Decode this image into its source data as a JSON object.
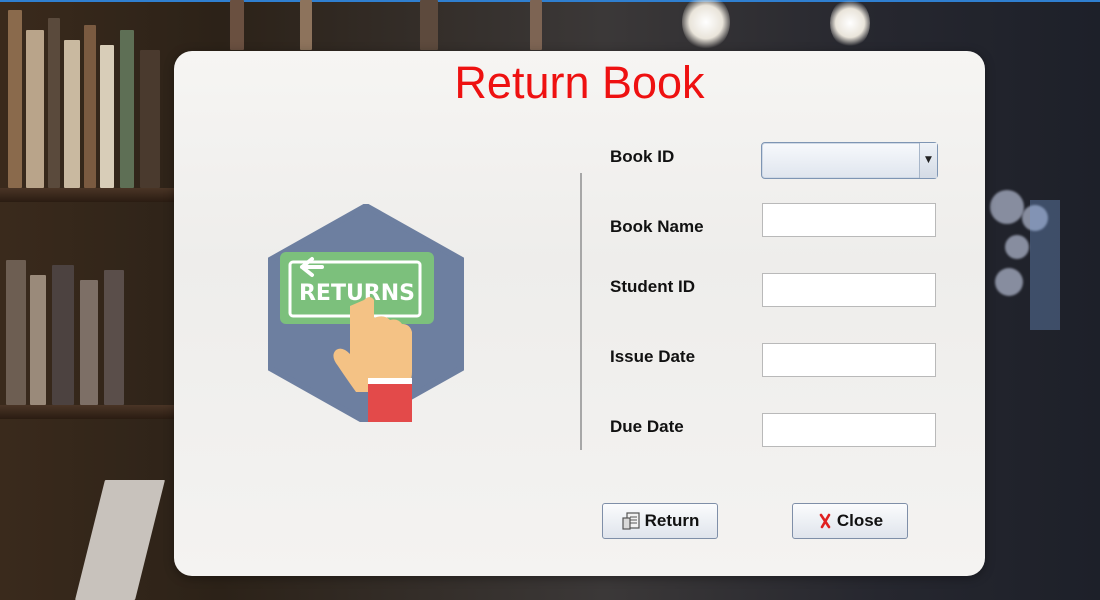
{
  "dialog": {
    "title": "Return Book",
    "illustration_text": "RETURNS",
    "form": {
      "book_id": {
        "label": "Book ID",
        "value": ""
      },
      "book_name": {
        "label": "Book Name",
        "value": ""
      },
      "student_id": {
        "label": "Student ID",
        "value": ""
      },
      "issue_date": {
        "label": "Issue Date",
        "value": ""
      },
      "due_date": {
        "label": "Due Date",
        "value": ""
      }
    },
    "buttons": {
      "return": {
        "label": "Return",
        "icon": "return-icon"
      },
      "close": {
        "label": "Close",
        "icon": "close-icon"
      }
    }
  },
  "colors": {
    "title": "#ee1111",
    "illustration_hexagon": "#6d7fa0",
    "illustration_sign": "#7cc07c",
    "close_x": "#e02020"
  }
}
